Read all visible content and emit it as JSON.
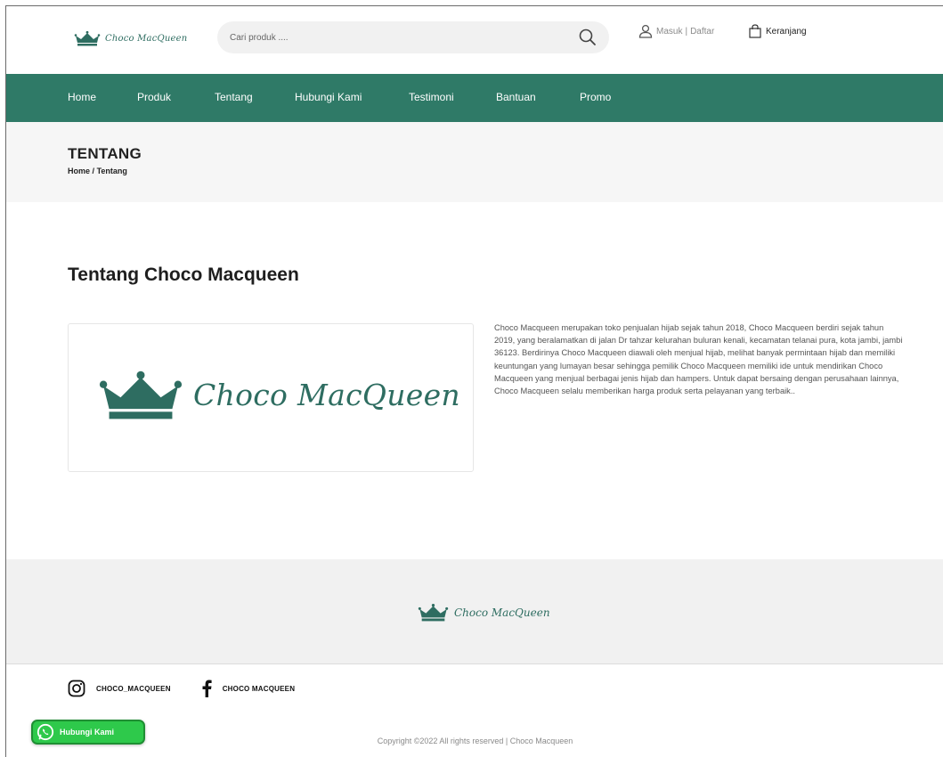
{
  "brand": {
    "name": "Choco MacQueen",
    "accent": "#2f7a67",
    "logo_color": "#2e6d61"
  },
  "header": {
    "search": {
      "placeholder": "Cari produk ....",
      "icon": "search-icon"
    },
    "account": {
      "icon": "user-icon",
      "login_label": "Masuk",
      "separator": "|",
      "register_label": "Daftar"
    },
    "cart": {
      "icon": "shopping-bag-icon",
      "label": "Keranjang"
    }
  },
  "nav": {
    "items": [
      {
        "label": "Home"
      },
      {
        "label": "Produk"
      },
      {
        "label": "Tentang"
      },
      {
        "label": "Hubungi Kami"
      },
      {
        "label": "Testimoni"
      },
      {
        "label": "Bantuan"
      },
      {
        "label": "Promo"
      }
    ]
  },
  "page": {
    "title": "TENTANG",
    "breadcrumb": {
      "home": "Home",
      "separator": "/",
      "current": "Tentang"
    }
  },
  "about": {
    "heading": "Tentang Choco Macqueen",
    "description": "Choco Macqueen merupakan toko penjualan hijab sejak tahun 2018, Choco Macqueen berdiri sejak tahun 2019, yang beralamatkan di jalan Dr tahzar kelurahan buluran kenali, kecamatan telanai pura, kota jambi, jambi 36123. Berdirinya Choco Macqueen diawali oleh menjual hijab, melihat banyak permintaan hijab dan memiliki keuntungan yang lumayan besar sehingga pemilik Choco Macqueen memiliki ide untuk mendirikan Choco Macqueen yang menjual berbagai jenis hijab dan hampers. Untuk dapat bersaing dengan perusahaan lainnya, Choco Macqueen selalu memberikan harga produk serta pelayanan yang terbaik.."
  },
  "footer": {
    "socials": [
      {
        "icon": "instagram-icon",
        "label": "CHOCO_MACQUEEN"
      },
      {
        "icon": "facebook-icon",
        "label": "CHOCO MACQUEEN"
      }
    ],
    "copyright": "Copyright ©2022 All rights reserved | Choco Macqueen"
  },
  "whatsapp": {
    "icon": "whatsapp-icon",
    "label": "Hubungi Kami",
    "color": "#2ec94b"
  }
}
